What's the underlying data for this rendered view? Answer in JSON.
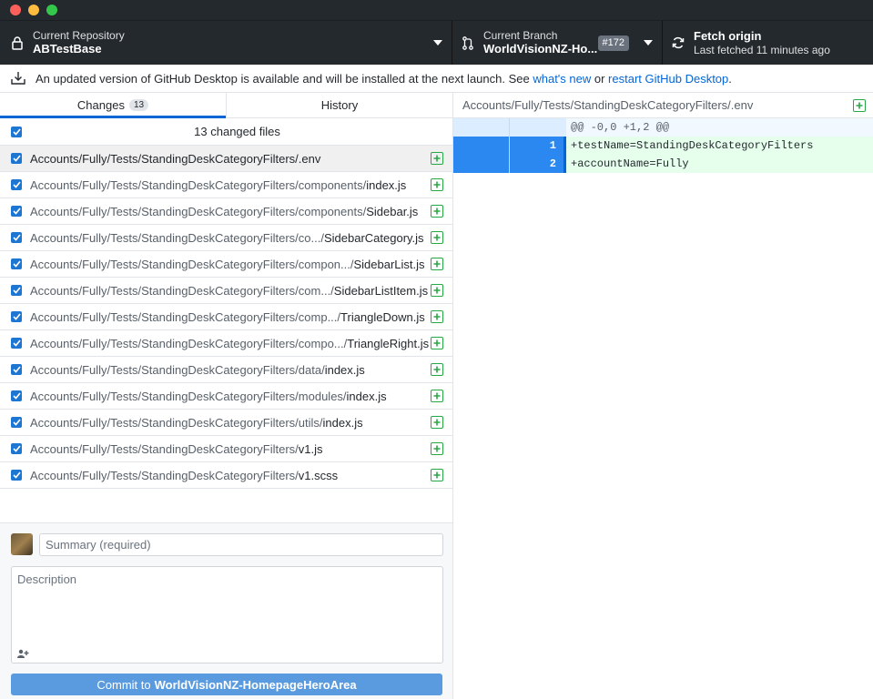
{
  "toolbar": {
    "repo_label": "Current Repository",
    "repo_value": "ABTestBase",
    "branch_label": "Current Branch",
    "branch_value": "WorldVisionNZ-Ho...",
    "pr_badge": "#172",
    "fetch_title": "Fetch origin",
    "fetch_sub": "Last fetched 11 minutes ago"
  },
  "banner": {
    "text_before": "An updated version of GitHub Desktop is available and will be installed at the next launch. See ",
    "link_whats_new": "what's new",
    "text_or": " or ",
    "link_restart": "restart GitHub Desktop",
    "text_after": "."
  },
  "tabs": {
    "changes_label": "Changes",
    "changes_count": "13",
    "history_label": "History"
  },
  "changes": {
    "header": "13 changed files",
    "files": [
      {
        "dir": "Accounts/Fully/Tests/StandingDeskCategoryFilters/",
        "name": ".env"
      },
      {
        "dir": "Accounts/Fully/Tests/StandingDeskCategoryFilters/components/",
        "name": "index.js"
      },
      {
        "dir": "Accounts/Fully/Tests/StandingDeskCategoryFilters/components/",
        "name": "Sidebar.js"
      },
      {
        "dir": "Accounts/Fully/Tests/StandingDeskCategoryFilters/co.../",
        "name": "SidebarCategory.js"
      },
      {
        "dir": "Accounts/Fully/Tests/StandingDeskCategoryFilters/compon.../",
        "name": "SidebarList.js"
      },
      {
        "dir": "Accounts/Fully/Tests/StandingDeskCategoryFilters/com.../",
        "name": "SidebarListItem.js"
      },
      {
        "dir": "Accounts/Fully/Tests/StandingDeskCategoryFilters/comp.../",
        "name": "TriangleDown.js"
      },
      {
        "dir": "Accounts/Fully/Tests/StandingDeskCategoryFilters/compo.../",
        "name": "TriangleRight.js"
      },
      {
        "dir": "Accounts/Fully/Tests/StandingDeskCategoryFilters/data/",
        "name": "index.js"
      },
      {
        "dir": "Accounts/Fully/Tests/StandingDeskCategoryFilters/modules/",
        "name": "index.js"
      },
      {
        "dir": "Accounts/Fully/Tests/StandingDeskCategoryFilters/utils/",
        "name": "index.js"
      },
      {
        "dir": "Accounts/Fully/Tests/StandingDeskCategoryFilters/",
        "name": "v1.js"
      },
      {
        "dir": "Accounts/Fully/Tests/StandingDeskCategoryFilters/",
        "name": "v1.scss"
      }
    ]
  },
  "commit": {
    "summary_placeholder": "Summary (required)",
    "description_placeholder": "Description",
    "button_prefix": "Commit to",
    "button_branch": "WorldVisionNZ-HomepageHeroArea"
  },
  "diff": {
    "file_path": "Accounts/Fully/Tests/StandingDeskCategoryFilters/.env",
    "hunk": "@@ -0,0 +1,2 @@",
    "lines": [
      {
        "new_num": "1",
        "text": "+testName=StandingDeskCategoryFilters"
      },
      {
        "new_num": "2",
        "text": "+accountName=Fully"
      }
    ]
  },
  "colors": {
    "accent": "#0366d6",
    "added_bg": "#e6ffed",
    "added_gutter": "#2a88f0",
    "commit_button": "#5a9be0",
    "add_icon": "#28a745"
  }
}
